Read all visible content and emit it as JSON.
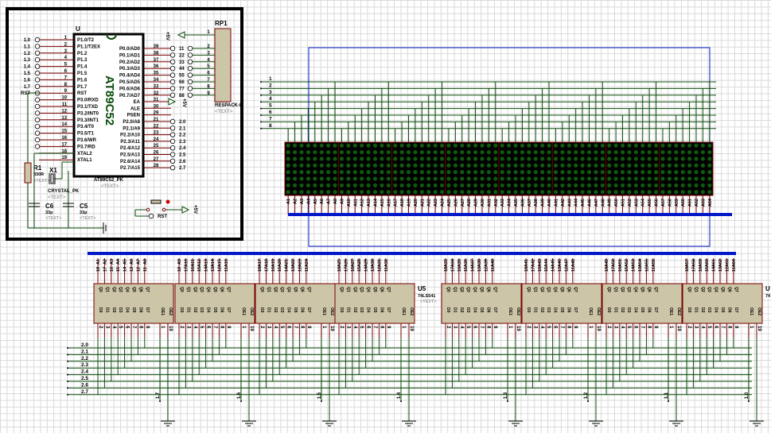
{
  "colors": {
    "wire": "#0b4d0b",
    "pin": "#7a0000",
    "chip_fill": "#ccc5a7",
    "bus": "#0018c8",
    "frame": "#000000",
    "led_on": "#0f5a0f",
    "led_bg": "#000000",
    "placeholder": "#a0a0a0"
  },
  "mcu": {
    "ref": "U",
    "part": "AT89C52",
    "part_label": "AT89C52_PK",
    "text": "<TEXT>",
    "left_pins": [
      {
        "num": "1",
        "name": "P1.0/T2",
        "net": "1.0"
      },
      {
        "num": "2",
        "name": "P1.1/T2EX",
        "net": "1.1"
      },
      {
        "num": "3",
        "name": "P1.2",
        "net": "1.2"
      },
      {
        "num": "4",
        "name": "P1.3",
        "net": "1.3"
      },
      {
        "num": "5",
        "name": "P1.4",
        "net": "1.4"
      },
      {
        "num": "6",
        "name": "P1.5",
        "net": "1.5"
      },
      {
        "num": "7",
        "name": "P1.6",
        "net": "1.6"
      },
      {
        "num": "8",
        "name": "P1.7",
        "net": "1.7"
      },
      {
        "num": "9",
        "name": "RST",
        "net": "RST"
      },
      {
        "num": "10",
        "name": "P3.0/RXD",
        "net": ""
      },
      {
        "num": "11",
        "name": "P3.1/TXD",
        "net": ""
      },
      {
        "num": "12",
        "name": "P3.2/INT0",
        "net": ""
      },
      {
        "num": "13",
        "name": "P3.3/INT1",
        "net": ""
      },
      {
        "num": "14",
        "name": "P3.4/T0",
        "net": ""
      },
      {
        "num": "15",
        "name": "P3.5/T1",
        "net": ""
      },
      {
        "num": "16",
        "name": "P3.6/WR",
        "net": ""
      },
      {
        "num": "17",
        "name": "P3.7/RD",
        "net": ""
      },
      {
        "num": "18",
        "name": "XTAL2",
        "net": ""
      },
      {
        "num": "19",
        "name": "XTAL1",
        "net": ""
      }
    ],
    "right_pins": [
      {
        "num": "39",
        "name": "P0.0/AD0",
        "net": "11"
      },
      {
        "num": "38",
        "name": "P0.1/AD1",
        "net": "22"
      },
      {
        "num": "37",
        "name": "P0.2/AD2",
        "net": "33"
      },
      {
        "num": "36",
        "name": "P0.3/AD3",
        "net": "44"
      },
      {
        "num": "35",
        "name": "P0.4/AD4",
        "net": "55"
      },
      {
        "num": "34",
        "name": "P0.5/AD5",
        "net": "66"
      },
      {
        "num": "33",
        "name": "P0.6/AD6",
        "net": "77"
      },
      {
        "num": "32",
        "name": "P0.7/AD7",
        "net": "88"
      },
      {
        "num": "31",
        "name": "EA",
        "net": "+5V"
      },
      {
        "num": "30",
        "name": "ALE",
        "net": ""
      },
      {
        "num": "29",
        "name": "PSEN",
        "net": ""
      },
      {
        "num": "21",
        "name": "P2.0/A8",
        "net": "2.0"
      },
      {
        "num": "22",
        "name": "P2.1/A9",
        "net": "2.1"
      },
      {
        "num": "23",
        "name": "P2.2/A10",
        "net": "2.2"
      },
      {
        "num": "24",
        "name": "P2.3/A11",
        "net": "2.3"
      },
      {
        "num": "25",
        "name": "P2.4/A12",
        "net": "2.4"
      },
      {
        "num": "26",
        "name": "P2.5/A13",
        "net": "2.5"
      },
      {
        "num": "27",
        "name": "P2.6/A14",
        "net": "2.6"
      },
      {
        "num": "28",
        "name": "P2.7/A15",
        "net": "2.7"
      }
    ]
  },
  "rp1": {
    "ref": "RP1",
    "part": "RESPACK-8",
    "text": "<TEXT>",
    "pins": [
      "1",
      "2",
      "3",
      "4",
      "5",
      "6",
      "7",
      "8",
      "9"
    ],
    "power": "+5V"
  },
  "r1": {
    "ref": "R1",
    "value": "330R",
    "text": "<TEXT>"
  },
  "x1": {
    "ref": "X1",
    "part": "CRYSTAL_PK",
    "text": "<TEXT>"
  },
  "c6": {
    "ref": "C6",
    "value": "33p",
    "text": "<TEXT>"
  },
  "c5": {
    "ref": "C5",
    "value": "33p",
    "text": "<TEXT>"
  },
  "reset": {
    "net": "RST",
    "power": "+5V"
  },
  "matrix": {
    "row_labels": [
      "1",
      "2",
      "3",
      "4",
      "5",
      "6",
      "7",
      "8"
    ],
    "modules": 8,
    "rows": 8,
    "cols_per_module": 8,
    "pins": [
      "A1",
      "A2",
      "A3",
      "A4",
      "A5",
      "A6",
      "A7",
      "A8",
      "A9",
      "A10",
      "A11",
      "A12",
      "A13",
      "A14",
      "A15",
      "A16",
      "A17",
      "A18",
      "A19",
      "A20",
      "A21",
      "A22",
      "A23",
      "A24",
      "A25",
      "A26",
      "A27",
      "A28",
      "A29",
      "A30",
      "A31",
      "A32",
      "A33",
      "A34",
      "A35",
      "A36",
      "A37",
      "A38",
      "A39",
      "A40",
      "A41",
      "A42",
      "A43",
      "A44",
      "A45",
      "A46",
      "A47",
      "A48",
      "A49",
      "A50",
      "A51",
      "A52",
      "A53",
      "A54",
      "A55",
      "A56",
      "A57",
      "A58",
      "A59",
      "A60",
      "A61",
      "A62",
      "A63",
      "A64"
    ]
  },
  "latches": {
    "ref": "U5",
    "part": "74LS541",
    "text": "<TEXT>",
    "edge_ref": "U",
    "edge_part": "74",
    "q_names": [
      "Q0",
      "Q1",
      "Q2",
      "Q3",
      "Q4",
      "Q5",
      "Q6",
      "Q7"
    ],
    "d_names": [
      "D0",
      "D1",
      "D2",
      "D3",
      "D4",
      "D5",
      "D6",
      "D7"
    ],
    "oe_names": [
      "OE1",
      "OE2"
    ],
    "q_pin_nums": [
      "18",
      "17",
      "16",
      "15",
      "14",
      "13",
      "12",
      "11"
    ],
    "d_pin_nums": [
      "2",
      "3",
      "4",
      "5",
      "6",
      "7",
      "8",
      "9"
    ],
    "oe_pin_nums": [
      "1",
      "19"
    ],
    "oe_nets": [
      "1.7",
      "1.6",
      "1.5",
      "1.4",
      "1.3",
      "1.2",
      "1.1",
      "1.0"
    ]
  },
  "p2_bus": [
    "2.0",
    "2.1",
    "2.2",
    "2.3",
    "2.4",
    "2.5",
    "2.6",
    "2.7"
  ]
}
